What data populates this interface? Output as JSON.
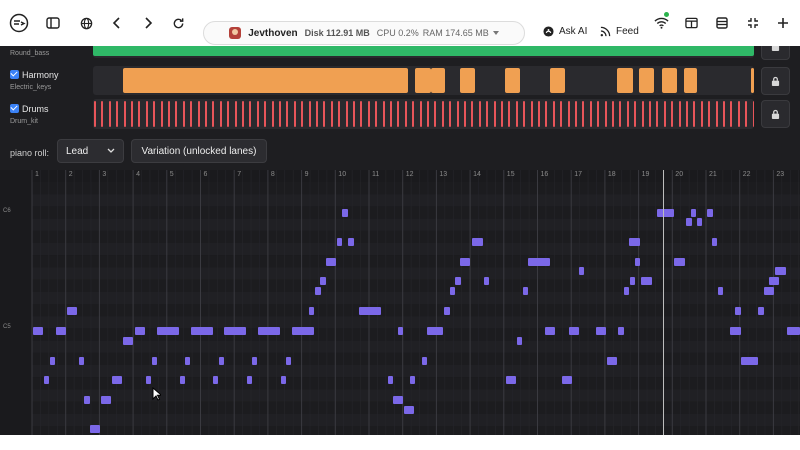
{
  "browser": {
    "site_name": "Jevthoven",
    "disk_label": "Disk 112.91 MB",
    "cpu_label": "CPU 0.2%",
    "ram_label": "RAM 174.65 MB",
    "ask_ai_label": "Ask AI",
    "feed_label": "Feed"
  },
  "lanes": [
    {
      "name": "",
      "instrument": "Round_bass",
      "color": "#2fb867"
    },
    {
      "name": "Harmony",
      "instrument": "Electric_keys",
      "color": "#f0a052"
    },
    {
      "name": "Drums",
      "instrument": "Drum_kit",
      "color": "#e8555a"
    }
  ],
  "controls": {
    "piano_roll_label": "piano roll:",
    "piano_roll_selected": "Lead",
    "variation_button": "Variation (unlocked lanes)"
  },
  "piano_roll": {
    "bars": [
      "1",
      "2",
      "3",
      "4",
      "5",
      "6",
      "7",
      "8",
      "9",
      "10",
      "11",
      "12",
      "13",
      "14",
      "15",
      "16",
      "17",
      "18",
      "19",
      "20",
      "21",
      "22",
      "23"
    ],
    "row_labels": [
      "C6",
      "C5"
    ],
    "note_color": "#7b68e8"
  }
}
